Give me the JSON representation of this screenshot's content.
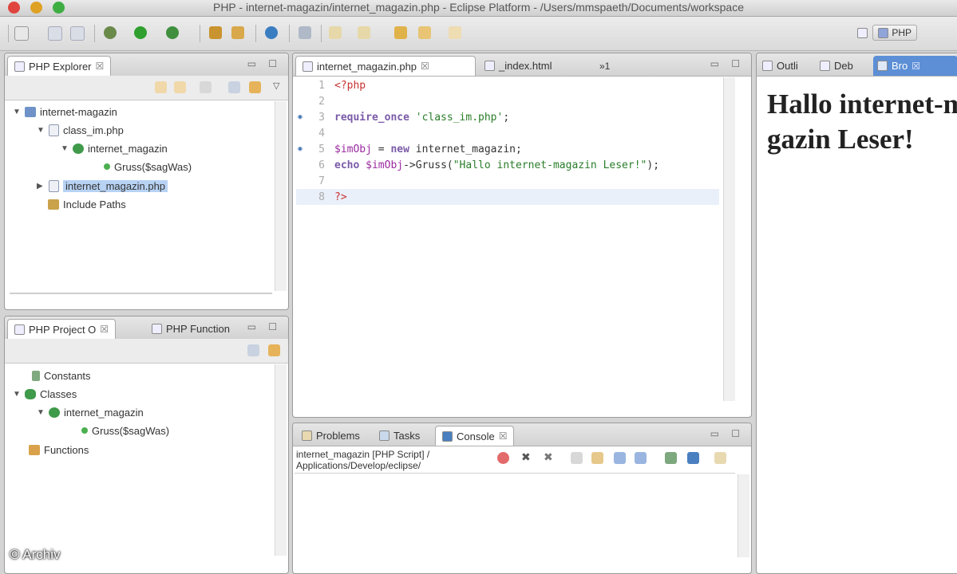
{
  "window": {
    "title": "PHP - internet-magazin/internet_magazin.php - Eclipse Platform - /Users/mmspaeth/Documents/workspace"
  },
  "toolbar": {
    "perspective_label": "PHP"
  },
  "php_explorer": {
    "tab_label": "PHP Explorer",
    "tree": [
      {
        "label": "internet-magazin"
      },
      {
        "label": "class_im.php"
      },
      {
        "label": "internet_magazin"
      },
      {
        "label": "Gruss($sagWas)"
      },
      {
        "label": "internet_magazin.php"
      },
      {
        "label": "Include Paths"
      }
    ]
  },
  "project_outline": {
    "tab_label": "PHP Project O",
    "second_tab_label": "PHP Function",
    "tree": [
      {
        "label": "Constants"
      },
      {
        "label": "Classes"
      },
      {
        "label": "internet_magazin"
      },
      {
        "label": "Gruss($sagWas)"
      },
      {
        "label": "Functions"
      }
    ]
  },
  "editor": {
    "tabs": [
      {
        "label": "internet_magazin.php"
      },
      {
        "label": "_index.html"
      },
      {
        "label": "»1"
      }
    ],
    "lines": [
      {
        "num": "1",
        "marker": "",
        "tokens": [
          {
            "t": "<?php",
            "c": "php"
          }
        ]
      },
      {
        "num": "2",
        "marker": "",
        "tokens": []
      },
      {
        "num": "3",
        "marker": "◉",
        "tokens": [
          {
            "t": "require_once",
            "c": "kw"
          },
          {
            "t": " ",
            "c": "plain"
          },
          {
            "t": "'class_im.php'",
            "c": "str"
          },
          {
            "t": ";",
            "c": "plain"
          }
        ]
      },
      {
        "num": "4",
        "marker": "",
        "tokens": []
      },
      {
        "num": "5",
        "marker": "◉",
        "tokens": [
          {
            "t": "$imObj",
            "c": "var"
          },
          {
            "t": " = ",
            "c": "plain"
          },
          {
            "t": "new",
            "c": "kw"
          },
          {
            "t": " internet_magazin;",
            "c": "plain"
          }
        ]
      },
      {
        "num": "6",
        "marker": "",
        "tokens": [
          {
            "t": "echo",
            "c": "kw"
          },
          {
            "t": " ",
            "c": "plain"
          },
          {
            "t": "$imObj",
            "c": "var"
          },
          {
            "t": "->Gruss(",
            "c": "plain"
          },
          {
            "t": "\"Hallo internet-magazin Leser!\"",
            "c": "str"
          },
          {
            "t": ");",
            "c": "plain"
          }
        ]
      },
      {
        "num": "7",
        "marker": "",
        "tokens": []
      },
      {
        "num": "8",
        "marker": "",
        "tokens": [
          {
            "t": "?>",
            "c": "php"
          }
        ]
      }
    ]
  },
  "bottom_panel": {
    "tabs": [
      {
        "label": "Problems"
      },
      {
        "label": "Tasks"
      },
      {
        "label": "Console"
      }
    ],
    "console_header_line1": "internet_magazin [PHP Script] /",
    "console_header_line2": "Applications/Develop/eclipse/"
  },
  "right_panel": {
    "tabs": [
      {
        "label": "Outli"
      },
      {
        "label": "Deb"
      },
      {
        "label": "Bro"
      }
    ],
    "browser_output": "Hallo internet-magazin Leser!"
  },
  "watermark": "© Archiv",
  "colors": {
    "selection": "#b7d2f3",
    "active_tab_highlight": "#5c8fd6",
    "line_highlight": "#eaf0fa"
  }
}
